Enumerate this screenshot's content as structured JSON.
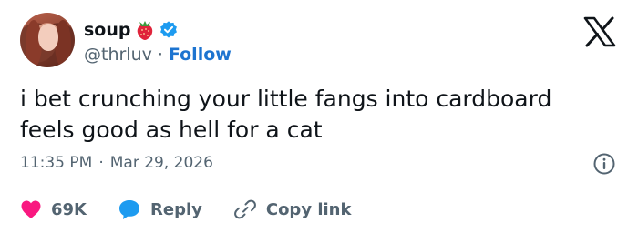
{
  "author": {
    "name": "soup",
    "handle": "@thrluv",
    "follow_label": "Follow",
    "separator": "·"
  },
  "tweet": {
    "text": "i bet crunching your little fangs into cardboard\nfeels good as hell for a cat",
    "time": "11:35 PM",
    "date": "Mar 29, 2026",
    "separator": "·"
  },
  "actions": {
    "like_count": "69K",
    "reply_label": "Reply",
    "copy_link_label": "Copy link"
  },
  "colors": {
    "like_heart": "#f91880",
    "reply_bubble": "#1d9bf0",
    "verified": "#1d9bf0",
    "follow": "#1d74d0",
    "secondary_text": "#536471"
  },
  "icons": [
    "strawberry-emoji-icon",
    "verified-badge-icon",
    "x-logo-icon",
    "info-icon",
    "heart-icon",
    "reply-bubble-icon",
    "link-icon"
  ]
}
